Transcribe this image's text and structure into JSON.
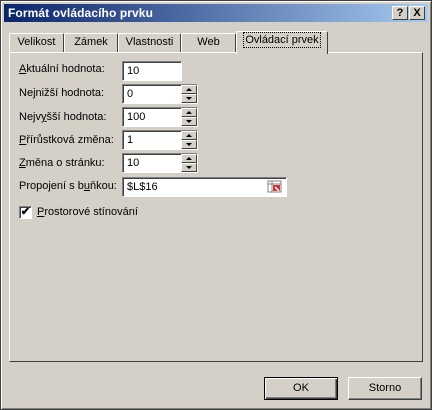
{
  "window": {
    "title": "Formát ovládacího prvku",
    "help_btn": "?",
    "close_btn": "X"
  },
  "tabs": [
    {
      "label": "Velikost",
      "active": false
    },
    {
      "label": "Zámek",
      "active": false
    },
    {
      "label": "Vlastnosti",
      "active": false
    },
    {
      "label": "Web",
      "active": false
    },
    {
      "label": "Ovládací prvek",
      "active": true
    }
  ],
  "fields": {
    "current": {
      "label_pre": "",
      "label_u": "A",
      "label_post": "ktuální hodnota:",
      "value": "10"
    },
    "min": {
      "label_pre": "Ne",
      "label_u": "j",
      "label_post": "nižší hodnota:",
      "value": "0"
    },
    "max": {
      "label_pre": "Nejv",
      "label_u": "y",
      "label_post": "šší hodnota:",
      "value": "100"
    },
    "increment": {
      "label_pre": "",
      "label_u": "P",
      "label_post": "řírůstková změna:",
      "value": "1"
    },
    "page_change": {
      "label_pre": "",
      "label_u": "Z",
      "label_post": "měna o stránku:",
      "value": "10"
    },
    "cell_link": {
      "label_pre": "Propojení s b",
      "label_u": "u",
      "label_post": "ňkou:",
      "value": "$L$16"
    }
  },
  "shading": {
    "checked": true,
    "mark": "✔",
    "label_u": "P",
    "label_post": "rostorové stínování"
  },
  "buttons": {
    "ok": "OK",
    "cancel": "Storno"
  },
  "icons": {
    "cell_ref": "range-select-icon"
  }
}
